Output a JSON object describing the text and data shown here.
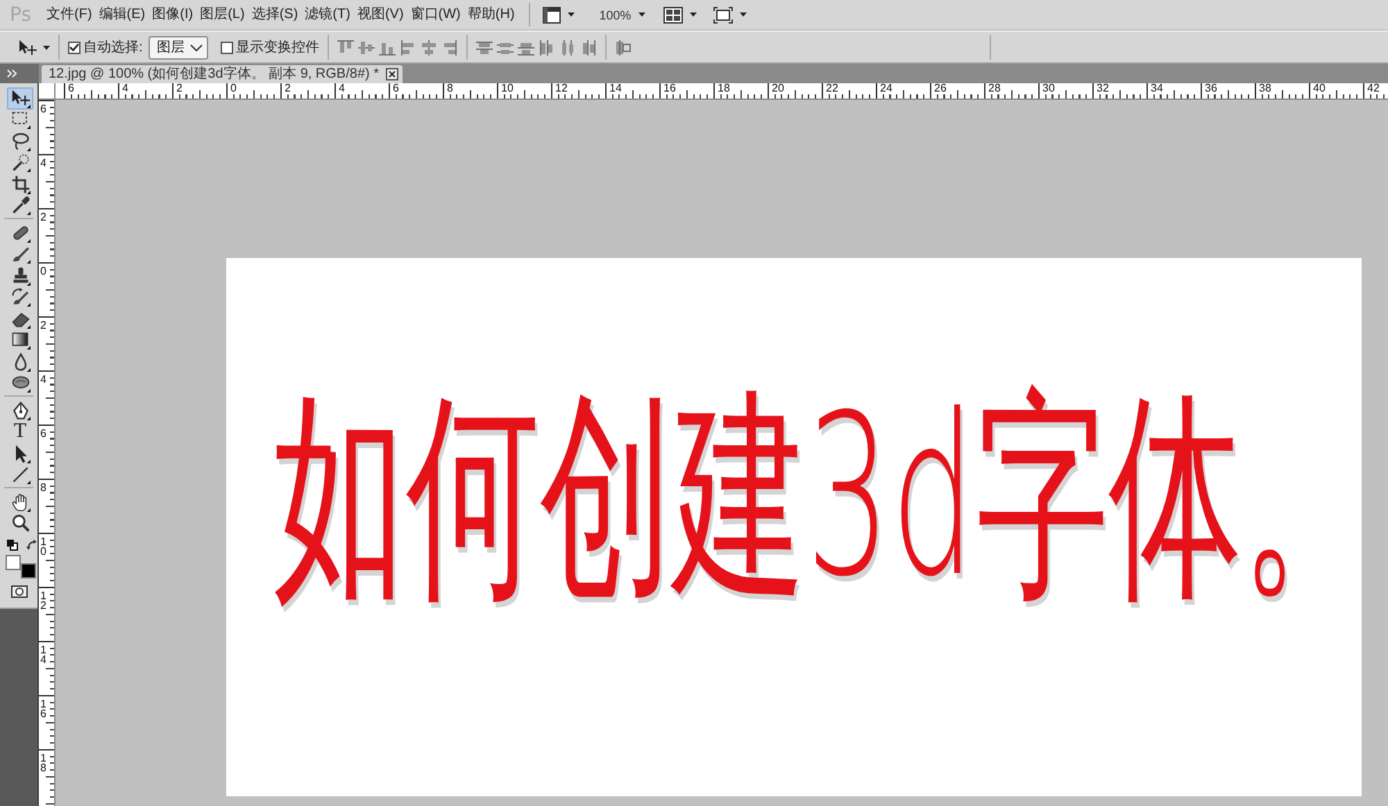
{
  "app": {
    "logo": "Ps"
  },
  "menu": [
    "文件(F)",
    "编辑(E)",
    "图像(I)",
    "图层(L)",
    "选择(S)",
    "滤镜(T)",
    "视图(V)",
    "窗口(W)",
    "帮助(H)"
  ],
  "view_controls": {
    "zoom": "100%"
  },
  "options_bar": {
    "auto_select": {
      "label": "自动选择:",
      "checked": true
    },
    "auto_select_target": "图层",
    "show_transform_controls": {
      "label": "显示变换控件",
      "checked": false
    }
  },
  "document_tab": {
    "title": "12.jpg @ 100% (如何创建3d字体。 副本 9, RGB/8#) *"
  },
  "toolbar": {
    "groups": [
      {
        "tools": [
          {
            "kind": "move",
            "selected": true
          },
          {
            "kind": "marquee",
            "selected": false
          },
          {
            "kind": "lasso",
            "selected": false
          },
          {
            "kind": "quick_select",
            "selected": false
          },
          {
            "kind": "crop",
            "selected": false
          },
          {
            "kind": "eyedropper",
            "selected": false
          }
        ]
      },
      {
        "tools": [
          {
            "kind": "healing",
            "selected": false
          },
          {
            "kind": "brush",
            "selected": false
          },
          {
            "kind": "stamp",
            "selected": false
          },
          {
            "kind": "history_brush",
            "selected": false
          },
          {
            "kind": "eraser",
            "selected": false
          },
          {
            "kind": "gradient",
            "selected": false
          },
          {
            "kind": "blur",
            "selected": false
          },
          {
            "kind": "sponge",
            "selected": false
          }
        ]
      },
      {
        "tools": [
          {
            "kind": "pen",
            "selected": false
          },
          {
            "kind": "type",
            "label": "T",
            "selected": false
          },
          {
            "kind": "path_select",
            "selected": false
          },
          {
            "kind": "line",
            "selected": false
          }
        ]
      },
      {
        "tools": [
          {
            "kind": "hand",
            "selected": false
          },
          {
            "kind": "zoom",
            "selected": false
          }
        ]
      }
    ],
    "swatches": [
      {
        "kind": "foreground",
        "color": "#ffffff"
      },
      {
        "kind": "background",
        "color": "#000000"
      }
    ]
  },
  "rulers": {
    "horizontal": [
      "6",
      "4",
      "2",
      "0",
      "2",
      "4",
      "6",
      "8",
      "10",
      "12",
      "14",
      "16",
      "18",
      "20",
      "22",
      "24",
      "26",
      "28",
      "30",
      "32",
      "34",
      "36",
      "38",
      "40",
      "42"
    ],
    "vertical": [
      "6",
      "4",
      "2",
      "0",
      "2",
      "4",
      "6",
      "8",
      "10",
      "12",
      "14",
      "16",
      "18"
    ]
  },
  "canvas": {
    "text": "如何创建3d字体。"
  }
}
